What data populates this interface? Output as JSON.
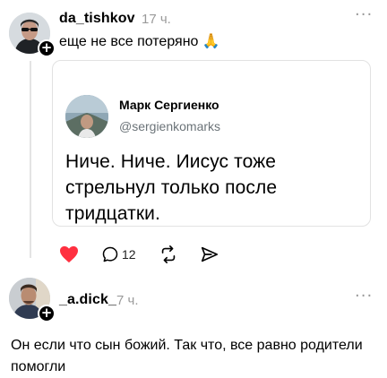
{
  "posts": [
    {
      "username": "da_tishkov",
      "time": "17 ч.",
      "text": "еще не все потеряно 🙏",
      "more_label": "···",
      "quote": {
        "author_name": "Марк Сергиенко",
        "author_handle": "@sergienkomarks",
        "text": "Ниче. Ниче. Иисус тоже стрельнул только после тридцатки."
      },
      "actions": {
        "like_icon": "heart-icon",
        "comment_icon": "comment-icon",
        "comment_count": "12",
        "repost_icon": "repost-icon",
        "share_icon": "send-icon"
      }
    },
    {
      "username": "_a.dick_",
      "time": "7 ч.",
      "text": "Он если что сын божий. Так что, все равно родители помогли",
      "more_label": "···"
    }
  ],
  "colors": {
    "like": "#ff3040",
    "muted": "#9a9a9a",
    "border": "#e2e2e2"
  }
}
